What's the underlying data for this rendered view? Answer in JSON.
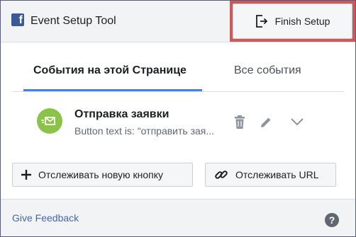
{
  "header": {
    "title": "Event Setup Tool",
    "logo_letter": "f",
    "finish_label": "Finish Setup"
  },
  "tabs": [
    {
      "label": "События на этой Странице",
      "active": true
    },
    {
      "label": "Все события",
      "active": false
    }
  ],
  "event": {
    "name": "Отправка заявки",
    "subtitle": "Button text is: \"отправить зая..."
  },
  "actions": {
    "track_new_button": "Отслеживать новую кнопку",
    "track_url": "Отслеживать URL"
  },
  "footer": {
    "feedback": "Give Feedback",
    "help": "?"
  },
  "colors": {
    "accent": "#4080ff",
    "highlight": "#cc5a5a",
    "event_icon": "#8bc34a",
    "link": "#4267b2"
  },
  "icons": [
    "facebook-logo",
    "exit-icon",
    "mail-icon",
    "trash-icon",
    "pencil-icon",
    "chevron-down-icon",
    "plus-icon",
    "link-icon",
    "help-icon"
  ]
}
